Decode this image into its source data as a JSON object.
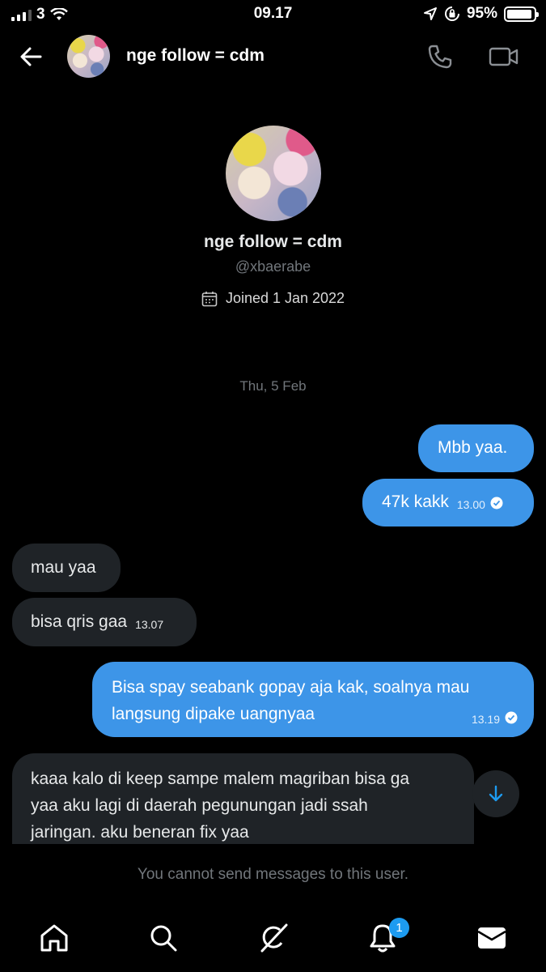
{
  "status_bar": {
    "carrier": "3",
    "time": "09.17",
    "battery_pct": "95%",
    "battery_level": 0.95,
    "icons": [
      "signal-icon",
      "wifi-icon",
      "location-icon",
      "rotation-lock-icon",
      "battery-icon"
    ]
  },
  "header": {
    "title": "nge follow = cdm",
    "icons": [
      "back-arrow-icon",
      "phone-icon",
      "video-camera-icon"
    ]
  },
  "profile": {
    "name": "nge follow = cdm",
    "handle": "@xbaerabe",
    "joined": "Joined 1 Jan 2022"
  },
  "date_divider": "Thu, 5 Feb",
  "messages": [
    {
      "side": "sent",
      "lines": [
        "Mbb yaa."
      ],
      "time": ""
    },
    {
      "side": "sent",
      "lines": [
        "47k kakk"
      ],
      "time": "13.00"
    },
    {
      "side": "recv",
      "lines": [
        "mau yaa"
      ],
      "time": ""
    },
    {
      "side": "recv",
      "lines": [
        "bisa qris gaa"
      ],
      "time": "13.07"
    },
    {
      "side": "sent",
      "lines": [
        "Bisa spay seabank gopay aja kak,  soalnya mau",
        "langsung dipake uangnyaa"
      ],
      "time": "13.19"
    },
    {
      "side": "recv",
      "lines": [
        "kaaa kalo di keep sampe malem magriban bisa ga",
        "yaa aku lagi di daerah pegunungan jadi ssah",
        "jaringan. aku beneran fix yaa"
      ],
      "time": ""
    }
  ],
  "footer_notice": "You cannot send messages to this user.",
  "tabbar": {
    "items": [
      "home-icon",
      "search-icon",
      "grok-icon",
      "notifications-icon",
      "messages-icon"
    ],
    "notification_badge": "1"
  },
  "colors": {
    "sent_bubble": "#3d95e8",
    "received_bubble": "#1f2327",
    "accent": "#1d9bf0"
  }
}
